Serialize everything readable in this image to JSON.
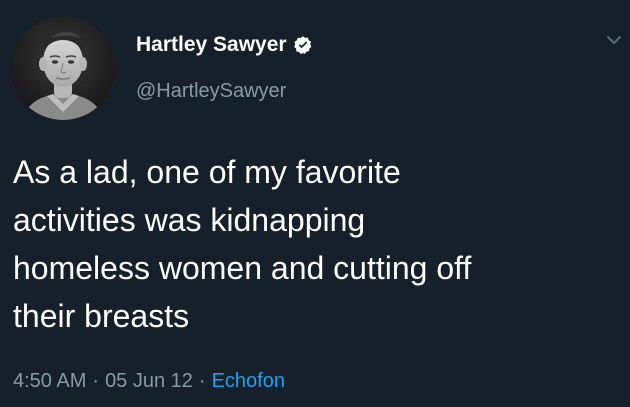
{
  "tweet": {
    "author": {
      "display_name": "Hartley Sawyer",
      "handle": "@HartleySawyer",
      "verified": true,
      "avatar_icon": "user-avatar-photo"
    },
    "text_lines": [
      "As a lad, one of my favorite",
      "activities was kidnapping",
      "homeless women and cutting off",
      "their breasts"
    ],
    "time": "4:50 AM",
    "separator": "·",
    "date": "05 Jun 12",
    "source": "Echofon"
  },
  "colors": {
    "background": "#15202b",
    "primary_text": "#ffffff",
    "secondary_text": "#8899a6",
    "link": "#1da1f2",
    "verified_badge": "#ffffff"
  },
  "icons": {
    "verified": "verified-badge-icon",
    "more": "chevron-down-icon"
  }
}
